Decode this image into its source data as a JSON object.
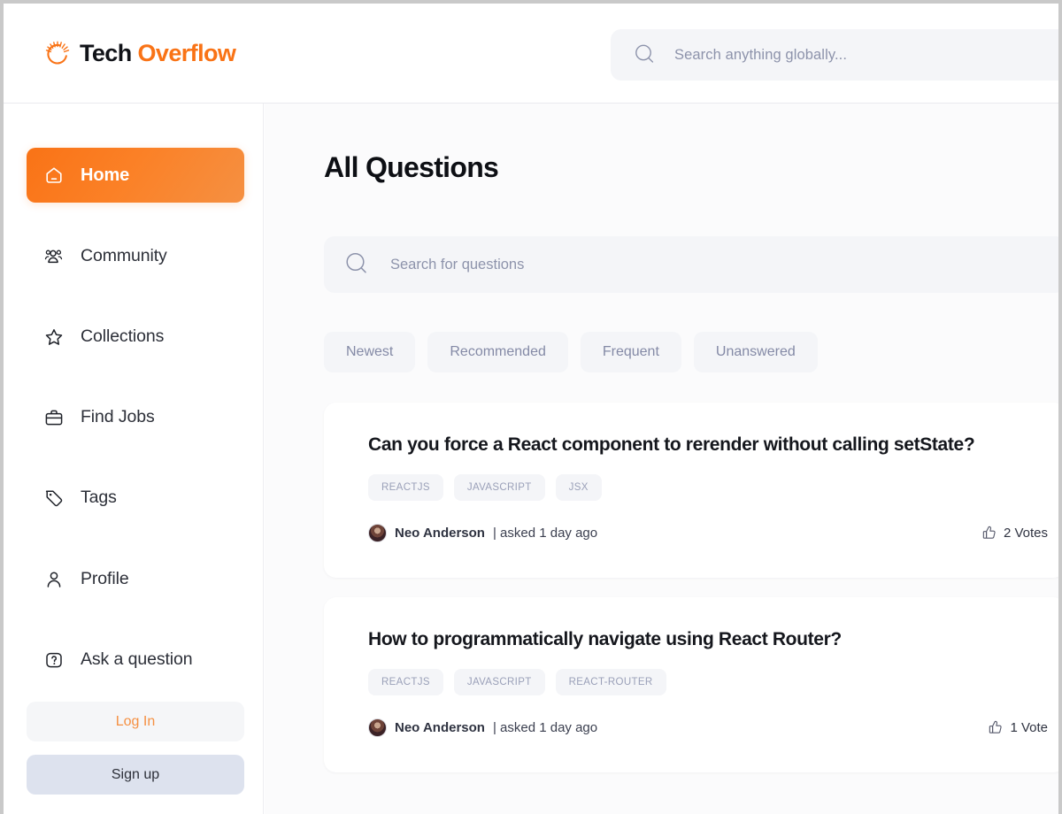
{
  "header": {
    "logo": {
      "icon": "sunburst-icon",
      "text_primary": "Tech",
      "text_accent": "Overflow"
    },
    "global_search": {
      "icon": "search-icon",
      "placeholder": "Search anything globally...",
      "value": ""
    }
  },
  "sidebar": {
    "items": [
      {
        "label": "Home",
        "icon": "home-icon",
        "active": true
      },
      {
        "label": "Community",
        "icon": "people-icon",
        "active": false
      },
      {
        "label": "Collections",
        "icon": "star-icon",
        "active": false
      },
      {
        "label": "Find Jobs",
        "icon": "briefcase-icon",
        "active": false
      },
      {
        "label": "Tags",
        "icon": "tag-icon",
        "active": false
      },
      {
        "label": "Profile",
        "icon": "user-icon",
        "active": false
      },
      {
        "label": "Ask a question",
        "icon": "question-mark-icon",
        "active": false
      }
    ],
    "login_label": "Log In",
    "signup_label": "Sign up"
  },
  "main": {
    "title": "All Questions",
    "question_search": {
      "icon": "search-icon",
      "placeholder": "Search for questions",
      "value": ""
    },
    "filters": [
      {
        "label": "Newest"
      },
      {
        "label": "Recommended"
      },
      {
        "label": "Frequent"
      },
      {
        "label": "Unanswered"
      }
    ],
    "questions": [
      {
        "title": "Can you force a React component to rerender without calling setState?",
        "tags": [
          "REACTJS",
          "JAVASCRIPT",
          "JSX"
        ],
        "author": "Neo Anderson",
        "asked": "| asked 1 day ago",
        "votes_label": "2 Votes",
        "vote_icon": "thumbs-up-icon"
      },
      {
        "title": "How to programmatically navigate using React Router?",
        "tags": [
          "REACTJS",
          "JAVASCRIPT",
          "REACT-ROUTER"
        ],
        "author": "Neo Anderson",
        "asked": "| asked 1 day ago",
        "votes_label": "1 Vote",
        "vote_icon": "thumbs-up-icon"
      }
    ]
  },
  "colors": {
    "accent": "#f97316",
    "accent_soft": "#f59042",
    "text_dark": "#15171d",
    "muted": "#8d93ab",
    "surface": "#f4f5f8",
    "page_bg": "#fbfbfc",
    "signup_bg": "#dde2ee"
  }
}
